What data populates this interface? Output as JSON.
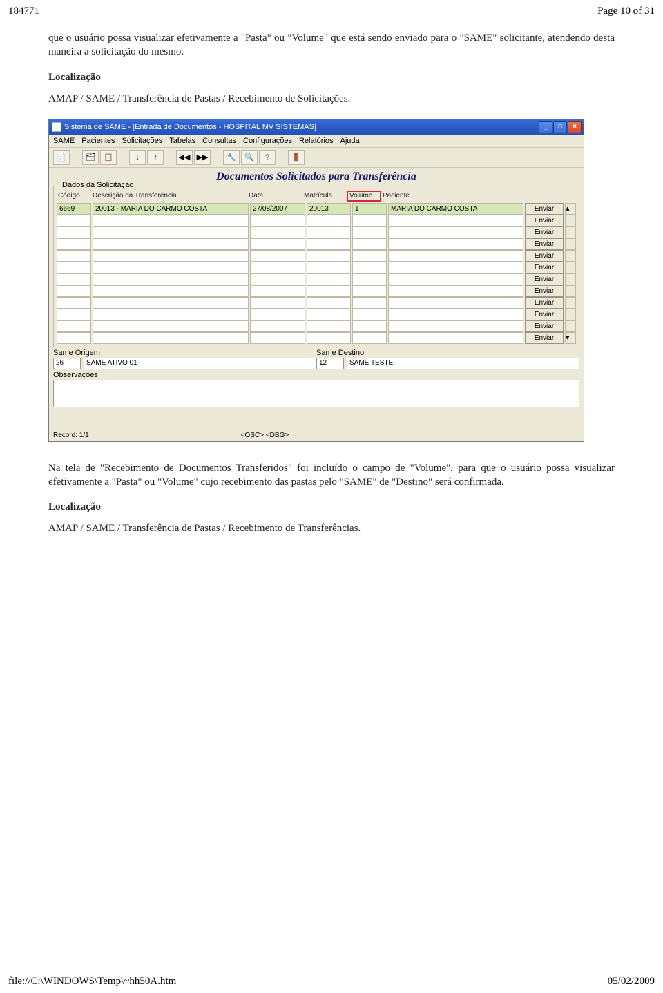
{
  "header": {
    "doc_id": "184771",
    "page_info": "Page 10 of 31"
  },
  "footer": {
    "path": "file://C:\\WINDOWS\\Temp\\~hh50A.htm",
    "date": "05/02/2009"
  },
  "text": {
    "para1": "que o usuário possa visualizar efetivamente a \"Pasta\" ou \"Volume\" que está sendo enviado para o \"SAME\" solicitante, atendendo desta maneira a solicitação do mesmo.",
    "loc_label": "Localização",
    "loc1_path": "AMAP / SAME / Transferência de Pastas / Recebimento de Solicitações.",
    "para2": "Na tela de \"Recebimento de Documentos Transferidos\" foi incluído o campo de \"Volume\", para que o usuário possa visualizar efetivamente a \"Pasta\" ou \"Volume\" cujo recebimento das pastas pelo \"SAME\" de \"Destino\" será confirmada.",
    "loc2_path": "AMAP / SAME / Transferência de Pastas / Recebimento de Transferências."
  },
  "app": {
    "title": "Sistema de SAME - [Entrada de Documentos - HOSPITAL MV SISTEMAS]",
    "menus": [
      "SAME",
      "Pacientes",
      "Solicitações",
      "Tabelas",
      "Consultas",
      "Configurações",
      "Relatórios",
      "Ajuda"
    ],
    "subtitle": "Documentos Solicitados para Transferência",
    "group_title": "Dados da Solicitação",
    "columns": {
      "codigo": "Código",
      "desc": "Descrição da Transferência",
      "data": "Data",
      "mat": "Matrícula",
      "vol": "Volume",
      "pac": "Paciente"
    },
    "row": {
      "codigo": "6669",
      "desc": "20013 - MARIA DO CARMO COSTA",
      "data": "27/08/2007",
      "mat": "20013",
      "vol": "1",
      "pac": "MARIA DO CARMO COSTA"
    },
    "btn_enviar": "Enviar",
    "same_origem_label": "Same Origem",
    "same_origem_code": "26",
    "same_origem_name": "SAME ATIVO 01",
    "same_destino_label": "Same Destino",
    "same_destino_code": "12",
    "same_destino_name": "SAME TESTE",
    "obs_label": "Observações",
    "status_record": "Record: 1/1",
    "status_mode": "<OSC> <DBG>"
  }
}
